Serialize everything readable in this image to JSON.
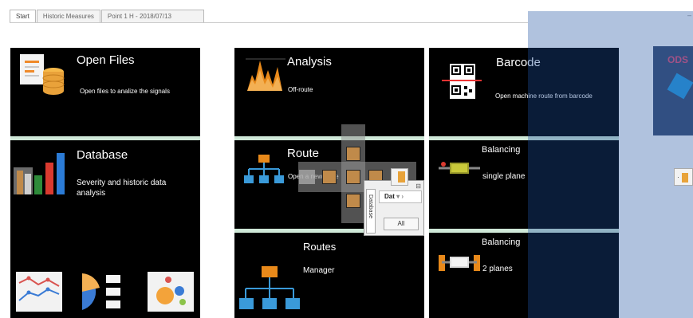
{
  "tabs": [
    {
      "label": "Start",
      "active": true
    },
    {
      "label": "Historic Measures",
      "active": false
    },
    {
      "label": "Point 1 H - 2018/07/13",
      "active": false
    }
  ],
  "tiles": {
    "open_files": {
      "title": "Open Files",
      "subtitle": "Open files to analize the signals"
    },
    "analysis": {
      "title": "Analysis",
      "subtitle": "Off-route"
    },
    "barcode": {
      "title": "Barcode",
      "subtitle": "Open machine route from barcode"
    },
    "database": {
      "title": "Database",
      "subtitle": "Severity and historic data analysis"
    },
    "route": {
      "title": "Route",
      "subtitle": "Open a new route"
    },
    "balancing_single": {
      "title": "Balancing",
      "subtitle": "single plane"
    },
    "routes": {
      "title": "Routes",
      "subtitle": "Manager"
    },
    "balancing_two": {
      "title": "Balancing",
      "subtitle": "2 planes"
    },
    "ods": {
      "title": "ODS"
    }
  },
  "popup": {
    "vertical_tab": "Database",
    "combo_value": "Dat",
    "button_label": "All"
  },
  "colors": {
    "tile_bg": "#000000",
    "separator": "#cfe8d8",
    "overlay": "#4f79b8",
    "accent_orange": "#e8891a",
    "accent_blue": "#2b9de0"
  }
}
